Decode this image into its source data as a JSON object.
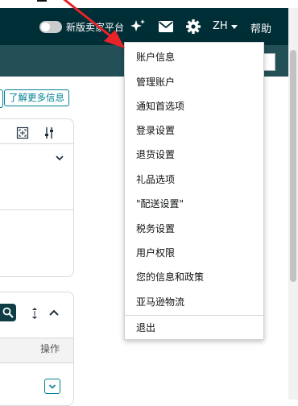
{
  "header": {
    "toggle_label": "新版卖家平台",
    "language": "ZH",
    "help": "帮助"
  },
  "page": {
    "learn_more": "了解更多信息",
    "operations_col": "操作"
  },
  "dropdown": {
    "items": [
      "账户信息",
      "管理账户",
      "通知首选项",
      "登录设置",
      "退货设置",
      "礼品选项",
      "\"配送设置\"",
      "税务设置",
      "用户权限",
      "您的信息和政策",
      "亚马逊物流"
    ],
    "logout": "退出"
  },
  "colors": {
    "header_bg": "#002e36",
    "subbar_bg": "#234f57",
    "link": "#008296",
    "arrow": "#e8232a"
  },
  "icons": [
    "sparkle-icon",
    "mail-icon",
    "gear-icon",
    "caret-down-icon",
    "search-icon",
    "expand-icon",
    "filter-icon",
    "chevron-down-icon",
    "sort-icon",
    "chevron-up-icon"
  ]
}
